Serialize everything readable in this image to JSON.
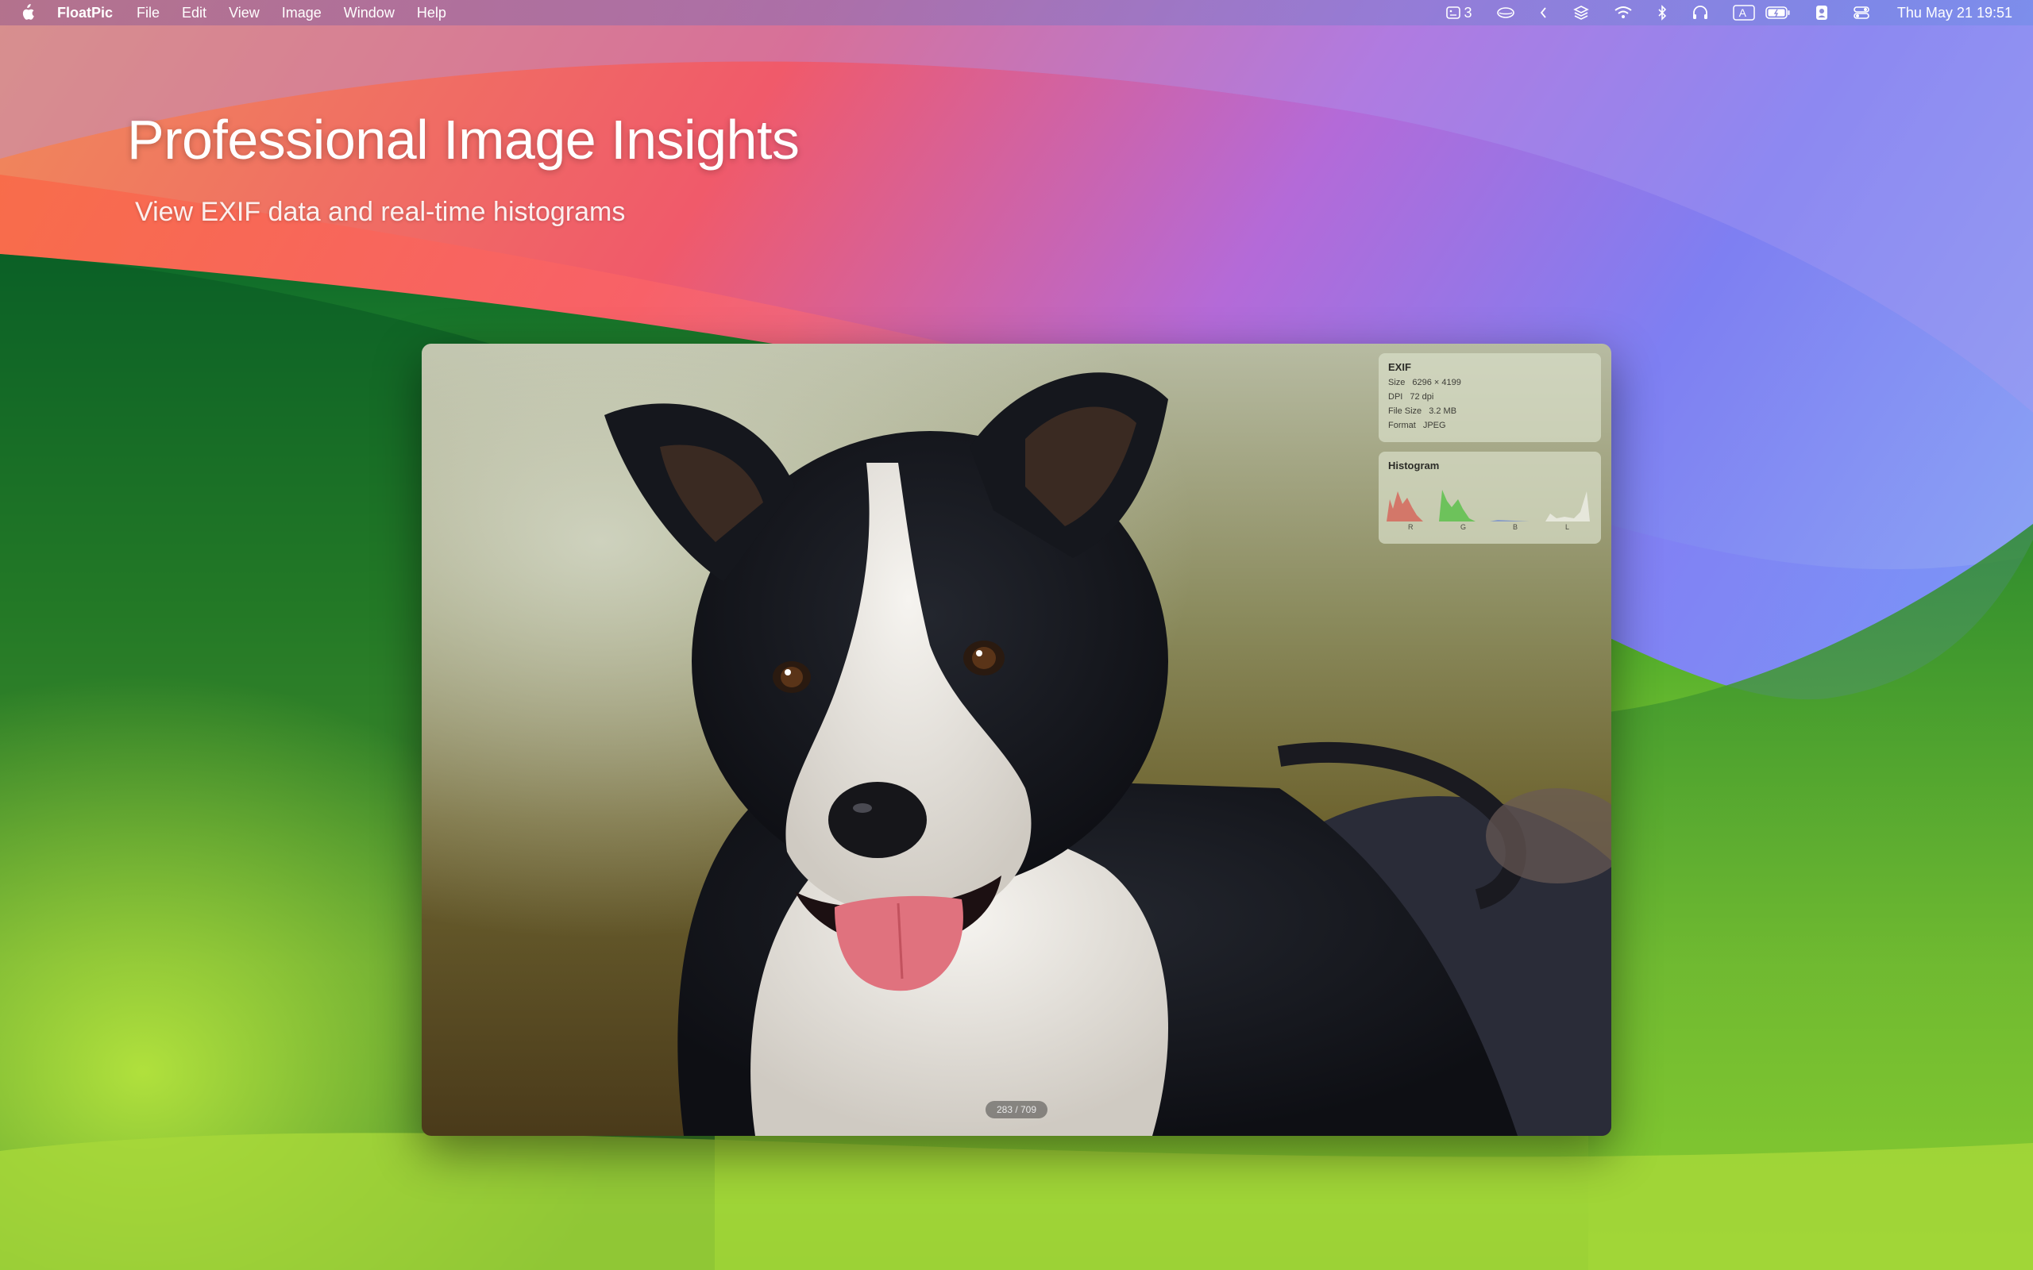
{
  "menubar": {
    "app_name": "FloatPic",
    "menus": [
      "File",
      "Edit",
      "View",
      "Image",
      "Window",
      "Help"
    ],
    "status_icons": [
      "stage-manager-icon",
      "cloud-drive-icon",
      "chevron-left-icon",
      "layers-icon",
      "wifi-icon",
      "bluetooth-icon",
      "headphones-icon",
      "input-source-icon",
      "battery-icon",
      "contact-card-icon",
      "control-center-icon"
    ],
    "stage_count": "3",
    "input_source": "A",
    "clock": "Thu May 21  19:51"
  },
  "hero": {
    "title": "Professional Image Insights",
    "subtitle": "View EXIF data and real-time histograms"
  },
  "viewer": {
    "exif": {
      "title": "EXIF",
      "rows": [
        {
          "key": "Size",
          "value": "6296 × 4199"
        },
        {
          "key": "DPI",
          "value": "72 dpi"
        },
        {
          "key": "File Size",
          "value": "3.2 MB"
        },
        {
          "key": "Format",
          "value": "JPEG"
        }
      ]
    },
    "histogram": {
      "title": "Histogram",
      "channels": [
        "R",
        "G",
        "B",
        "L"
      ],
      "colors": {
        "R": "#d9524a",
        "G": "#4fbf3f",
        "B": "#5a7bd8",
        "L": "#f0f0ea"
      }
    },
    "counter": "283 / 709"
  }
}
